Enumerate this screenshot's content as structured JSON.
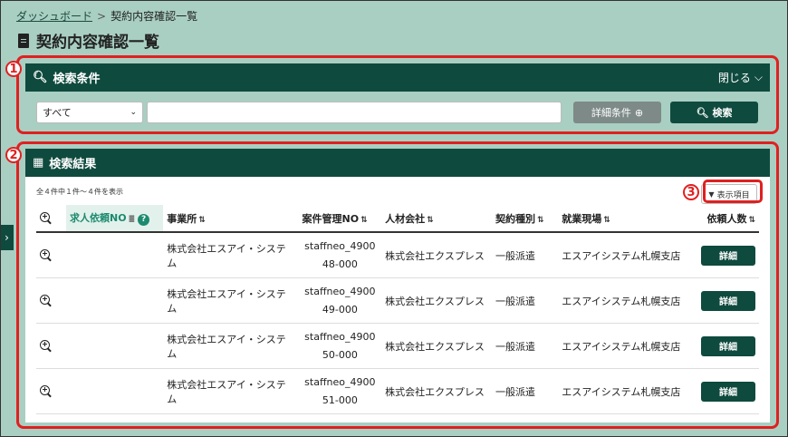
{
  "breadcrumb": {
    "home": "ダッシュボード",
    "separator": ">",
    "current": "契約内容確認一覧"
  },
  "page": {
    "title": "契約内容確認一覧",
    "title_icon": "document-icon"
  },
  "search_panel": {
    "marker": "1",
    "title": "検索条件",
    "title_icon": "search-icon",
    "close_label": "閉じる",
    "select_value": "すべて",
    "input_value": "",
    "detail_button": "詳細条件",
    "search_button": "検索"
  },
  "results_panel": {
    "marker": "2",
    "title": "検索結果",
    "title_icon": "table-icon",
    "count_text": "全４件中１件～４件を表示",
    "columns_marker": "3",
    "columns_button": "表示項目",
    "headers": {
      "job_request_no": "求人依頼NO",
      "office": "事業所",
      "case_no": "案件管理NO",
      "staffing_company": "人材会社",
      "contract_type": "契約種別",
      "work_site": "就業現場",
      "request_count": "依頼人数"
    },
    "rows": [
      {
        "office": "株式会社エスアイ・システム",
        "case_no_1": "staffneo_4900",
        "case_no_2": "48-000",
        "company": "株式会社エクスプレス",
        "contract": "一般派遣",
        "site": "エスアイシステム札幌支店",
        "button": "詳細"
      },
      {
        "office": "株式会社エスアイ・システム",
        "case_no_1": "staffneo_4900",
        "case_no_2": "49-000",
        "company": "株式会社エクスプレス",
        "contract": "一般派遣",
        "site": "エスアイシステム札幌支店",
        "button": "詳細"
      },
      {
        "office": "株式会社エスアイ・システム",
        "case_no_1": "staffneo_4900",
        "case_no_2": "50-000",
        "company": "株式会社エクスプレス",
        "contract": "一般派遣",
        "site": "エスアイシステム札幌支店",
        "button": "詳細"
      },
      {
        "office": "株式会社エスアイ・システム",
        "case_no_1": "staffneo_4900",
        "case_no_2": "51-000",
        "company": "株式会社エクスプレス",
        "contract": "一般派遣",
        "site": "エスアイシステム札幌支店",
        "button": "詳細"
      }
    ]
  },
  "colors": {
    "header_green": "#0f4a3e",
    "background": "#a9cfc2",
    "annotation_red": "#e02020"
  }
}
